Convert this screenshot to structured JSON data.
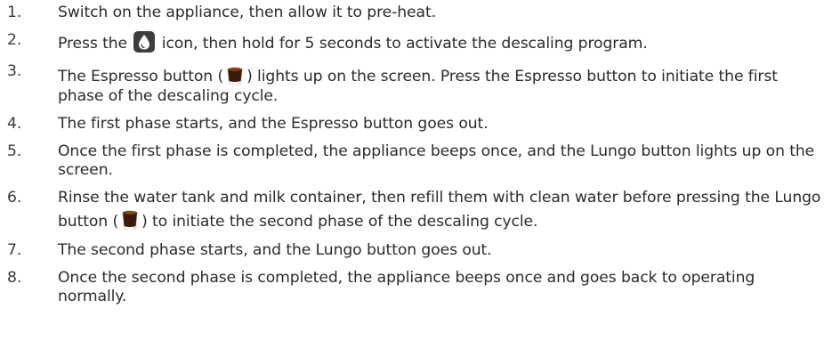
{
  "steps": [
    {
      "num": "1.",
      "text": "Switch on the appliance, then allow it to pre-heat."
    },
    {
      "num": "2.",
      "pre": "Press the",
      "icon": "water-drop-icon",
      "post": "icon, then hold for 5 seconds to activate the descaling program."
    },
    {
      "num": "3.",
      "pre": "The Espresso button (",
      "icon": "espresso-cup-icon",
      "post": ") lights up on the screen. Press the Espresso button to initiate the first phase of the descaling cycle."
    },
    {
      "num": "4.",
      "text": "The first phase starts, and the Espresso button goes out."
    },
    {
      "num": "5.",
      "text": "Once the first phase is completed, the appliance beeps once, and the Lungo button lights up on the screen."
    },
    {
      "num": "6.",
      "pre": "Rinse the water tank and milk container, then refill them with clean water before pressing the Lungo button (",
      "icon": "lungo-cup-icon",
      "post": ") to initiate the second phase of the descaling cycle."
    },
    {
      "num": "7.",
      "text": "The second phase starts, and the Lungo button goes out."
    },
    {
      "num": "8.",
      "text": "Once the second phase is completed, the appliance beeps once and goes back to operating normally."
    }
  ],
  "colors": {
    "text": "#2b2b2b",
    "icon_bg": "#3d3d3d",
    "coffee_dark": "#3b1a0c",
    "coffee_cup": "#f7f2ea"
  }
}
